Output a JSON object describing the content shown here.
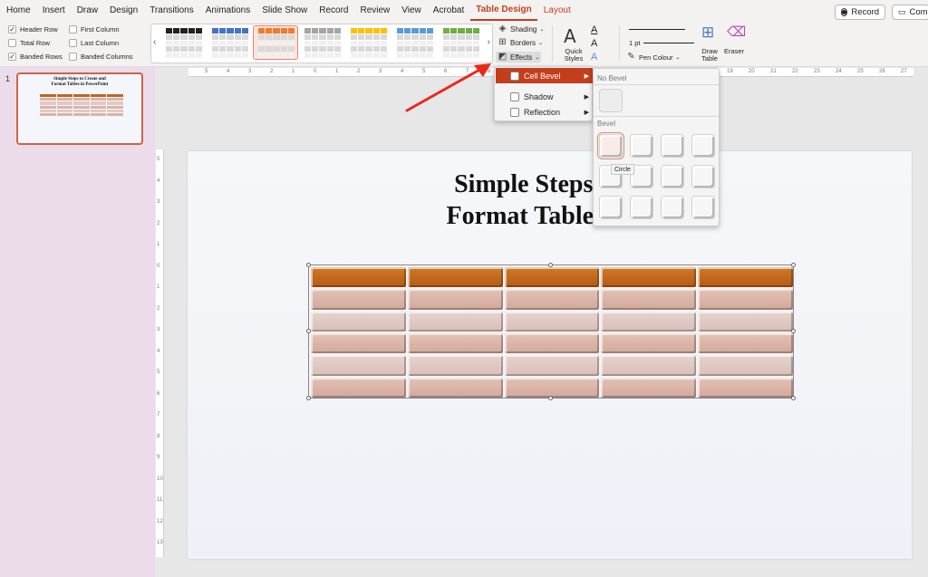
{
  "tabs": [
    "Home",
    "Insert",
    "Draw",
    "Design",
    "Transitions",
    "Animations",
    "Slide Show",
    "Record",
    "Review",
    "View",
    "Acrobat",
    "Table Design",
    "Layout"
  ],
  "active_tab": "Table Design",
  "top_right": {
    "record_label": "Record",
    "comments_label": "Com"
  },
  "style_options": {
    "header_row": "Header Row",
    "total_row": "Total Row",
    "banded_rows": "Banded Rows",
    "first_column": "First Column",
    "last_column": "Last Column",
    "banded_columns": "Banded Columns",
    "checked": {
      "header_row": true,
      "total_row": false,
      "banded_rows": true,
      "first_column": false,
      "last_column": false,
      "banded_columns": false
    }
  },
  "ribbon": {
    "shading": "Shading",
    "borders": "Borders",
    "effects": "Effects",
    "quick_styles_1": "Quick",
    "quick_styles_2": "Styles",
    "pen_weight": "1 pt",
    "pen_colour": "Pen Colour",
    "draw_table_1": "Draw",
    "draw_table_2": "Table",
    "eraser": "Eraser"
  },
  "gallery_colors": [
    "#222222",
    "#4472c4",
    "#ed7d31",
    "#a5a5a5",
    "#ffc000",
    "#5b9bd5",
    "#70ad47"
  ],
  "slide_panel": {
    "number": "1",
    "title_line1": "Simple Steps to Create and",
    "title_line2": "Format Tables in PowerPoint"
  },
  "slide": {
    "title_line1": "Simple Steps to C",
    "title_line2": "Format Tables in P"
  },
  "ruler_h": [
    "5",
    "4",
    "3",
    "2",
    "1",
    "0",
    "1",
    "2",
    "3",
    "4",
    "5",
    "6",
    "7",
    "8",
    "9",
    "10",
    "11",
    "12",
    "13",
    "14",
    "15",
    "16",
    "17",
    "18",
    "19",
    "20",
    "21",
    "22",
    "23",
    "24",
    "25",
    "26",
    "27"
  ],
  "ruler_v": [
    "5",
    "4",
    "3",
    "2",
    "1",
    "0",
    "1",
    "2",
    "3",
    "4",
    "5",
    "6",
    "7",
    "8",
    "9",
    "10",
    "11",
    "12",
    "13"
  ],
  "effects_menu": {
    "items": [
      "Cell Bevel",
      "Shadow",
      "Reflection"
    ]
  },
  "bevel_panel": {
    "no_bevel": "No Bevel",
    "bevel": "Bevel",
    "tooltip": "Circle"
  },
  "colors": {
    "accent": "#c43e1c",
    "header_cell": "#c0651d",
    "band1": "#dbb3a6",
    "band2": "#e0c9c2"
  }
}
